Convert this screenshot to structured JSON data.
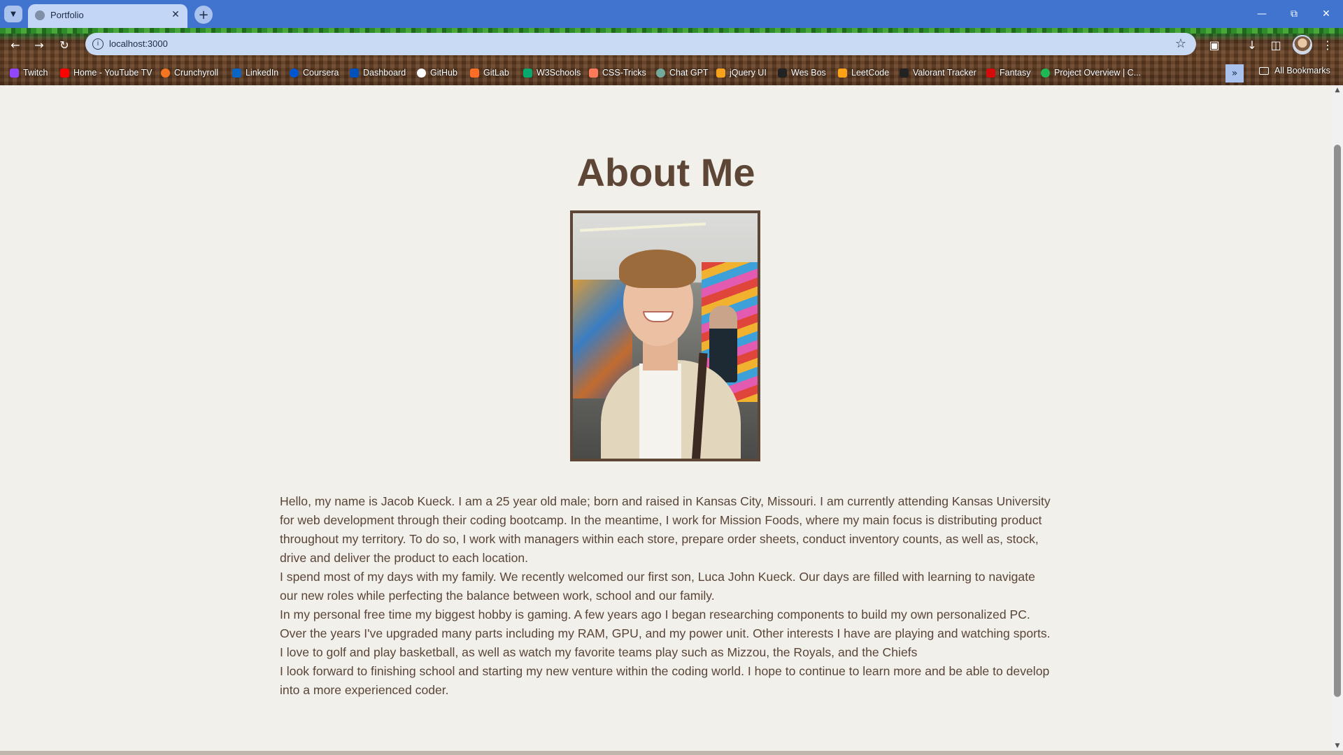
{
  "browser": {
    "tab_title": "Portfolio",
    "url": "localhost:3000",
    "bookmarks": [
      {
        "label": "Twitch",
        "icon": "twitch-icon",
        "color": "#9146ff"
      },
      {
        "label": "Home - YouTube TV",
        "icon": "youtube-icon",
        "color": "#ff0000"
      },
      {
        "label": "Crunchyroll",
        "icon": "crunchyroll-icon",
        "color": "#f47521"
      },
      {
        "label": "LinkedIn",
        "icon": "linkedin-icon",
        "color": "#0a66c2"
      },
      {
        "label": "Coursera",
        "icon": "coursera-icon",
        "color": "#0056d2"
      },
      {
        "label": "Dashboard",
        "icon": "ku-icon",
        "color": "#0051ba"
      },
      {
        "label": "GitHub",
        "icon": "github-icon",
        "color": "#ffffff"
      },
      {
        "label": "GitLab",
        "icon": "gitlab-icon",
        "color": "#fc6d26"
      },
      {
        "label": "W3Schools",
        "icon": "w3schools-icon",
        "color": "#04aa6d"
      },
      {
        "label": "CSS-Tricks",
        "icon": "css-tricks-icon",
        "color": "#ff7a59"
      },
      {
        "label": "Chat GPT",
        "icon": "chatgpt-icon",
        "color": "#74aa9c"
      },
      {
        "label": "jQuery UI",
        "icon": "jquery-icon",
        "color": "#f7a21b"
      },
      {
        "label": "Wes Bos",
        "icon": "wesbos-icon",
        "color": "#222222"
      },
      {
        "label": "LeetCode",
        "icon": "leetcode-icon",
        "color": "#ffa116"
      },
      {
        "label": "Valorant Tracker",
        "icon": "tracker-icon",
        "color": "#222222"
      },
      {
        "label": "Fantasy",
        "icon": "fantasy-icon",
        "color": "#d50a0a"
      },
      {
        "label": "Project Overview | C...",
        "icon": "project-icon",
        "color": "#1db954"
      }
    ],
    "all_bookmarks_label": "All Bookmarks"
  },
  "page": {
    "title": "About Me",
    "bio": [
      "Hello, my name is Jacob Kueck. I am a 25 year old male; born and raised in Kansas City, Missouri. I am currently attending Kansas University for web development through their coding bootcamp. In the meantime, I work for Mission Foods, where my main focus is distributing product throughout my territory. To do so, I work with managers within each store, prepare order sheets, conduct inventory counts, as well as, stock, drive and deliver the product to each location.",
      "I spend most of my days with my family. We recently welcomed our first son, Luca John Kueck. Our days are filled with learning to navigate our new roles while perfecting the balance between work, school and our family.",
      "In my personal free time my biggest hobby is gaming. A few years ago I began researching components to build my own personalized PC. Over the years I've upgraded many parts including my RAM, GPU, and my power unit. Other interests I have are playing and watching sports. I love to golf and play basketball, as well as watch my favorite teams play such as Mizzou, the Royals, and the Chiefs",
      "I look forward to finishing school and starting my new venture within the coding world. I hope to continue to learn more and be able to develop into a more experienced coder."
    ]
  },
  "colors": {
    "heading": "#5e4637",
    "body_text": "#5a4538",
    "page_bg": "#f1f0eb",
    "tabstrip": "#4174cf"
  }
}
